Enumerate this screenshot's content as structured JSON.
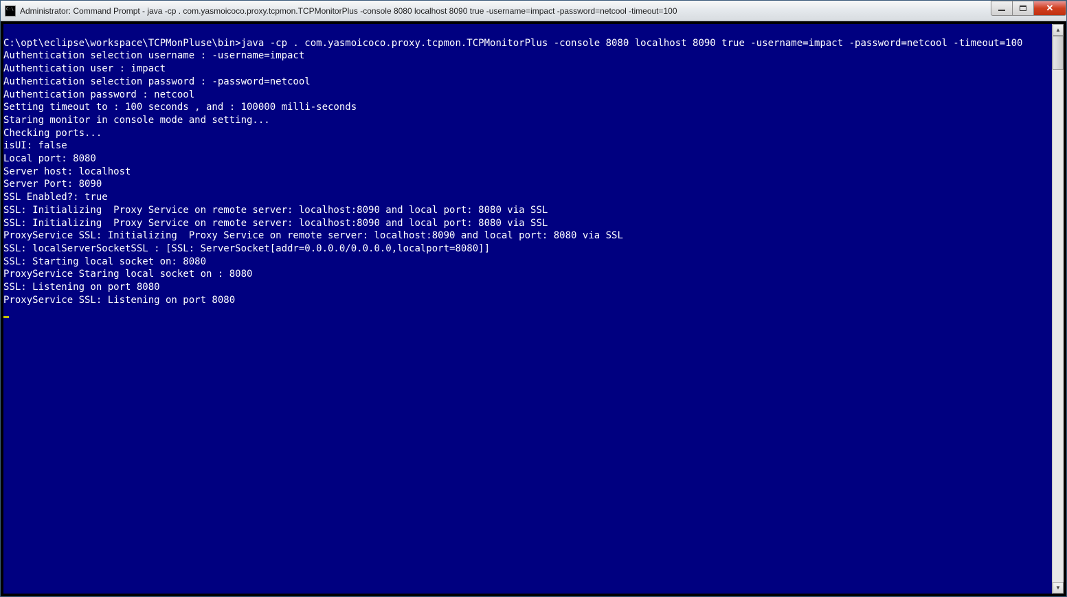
{
  "window": {
    "title": "Administrator: Command Prompt - java  -cp . com.yasmoicoco.proxy.tcpmon.TCPMonitorPlus -console 8080 localhost 8090 true -username=impact -password=netcool -timeout=100"
  },
  "console": {
    "blank_line": "",
    "prompt": "C:\\opt\\eclipse\\workspace\\TCPMonPluse\\bin>",
    "command": "java -cp . com.yasmoicoco.proxy.tcpmon.TCPMonitorPlus -console 8080 localhost 8090 true -username=impact -password=netcool -timeout=100",
    "lines": [
      "Authentication selection username : -username=impact",
      "Authentication user : impact",
      "Authentication selection password : -password=netcool",
      "Authentication password : netcool",
      "Setting timeout to : 100 seconds , and : 100000 milli-seconds",
      "Staring monitor in console mode and setting...",
      "Checking ports...",
      "isUI: false",
      "Local port: 8080",
      "Server host: localhost",
      "Server Port: 8090",
      "SSL Enabled?: true",
      "SSL: Initializing  Proxy Service on remote server: localhost:8090 and local port: 8080 via SSL",
      "SSL: Initializing  Proxy Service on remote server: localhost:8090 and local port: 8080 via SSL",
      "ProxyService SSL: Initializing  Proxy Service on remote server: localhost:8090 and local port: 8080 via SSL",
      "SSL: localServerSocketSSL : [SSL: ServerSocket[addr=0.0.0.0/0.0.0.0,localport=8080]]",
      "SSL: Starting local socket on: 8080",
      "ProxyService Staring local socket on : 8080",
      "SSL: Listening on port 8080",
      "ProxyService SSL: Listening on port 8080"
    ]
  }
}
